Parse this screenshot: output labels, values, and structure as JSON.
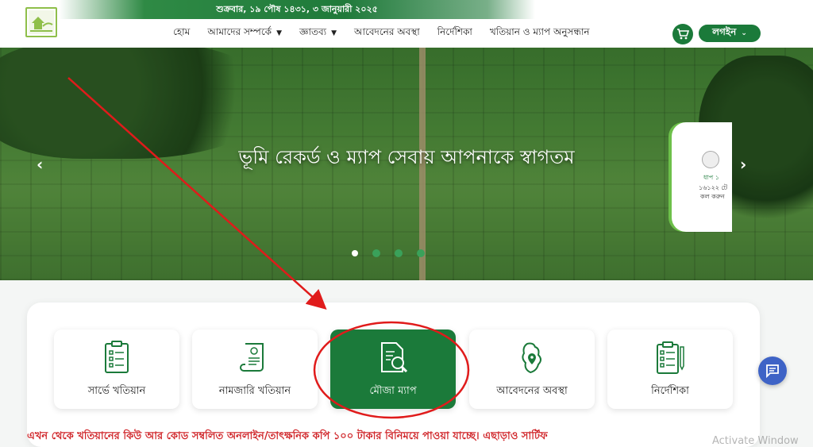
{
  "header": {
    "date_text": "শুক্রবার, ১৯ পৌষ ১৪৩১, ৩ জানুয়ারী ২০২৫",
    "logo_icon": "house-land-logo-icon",
    "nav": [
      {
        "label": "হোম",
        "has_dropdown": false
      },
      {
        "label": "আমাদের সম্পর্কে",
        "has_dropdown": true
      },
      {
        "label": "জ্ঞাতব্য",
        "has_dropdown": true
      },
      {
        "label": "আবেদনের অবস্থা",
        "has_dropdown": false
      },
      {
        "label": "নির্দেশিকা",
        "has_dropdown": false
      },
      {
        "label": "খতিয়ান ও ম্যাপ অনুসন্ধান",
        "has_dropdown": false
      }
    ],
    "cart_icon": "cart-icon",
    "login_label": "লগইন"
  },
  "hero": {
    "title": "ভূমি রেকর্ড ও ম্যাপ সেবায় আপনাকে স্বাগতম",
    "prev_icon": "chevron-left-icon",
    "next_icon": "chevron-right-icon",
    "slide_count": 4,
    "active_slide": 0,
    "side_card": {
      "line1": "ধাপ ১",
      "line2": "১৬১২২ টে",
      "line3": "কল করুন"
    }
  },
  "services": {
    "cards": [
      {
        "label": "সার্ভে খতিয়ান",
        "icon": "survey-document-icon",
        "active": false
      },
      {
        "label": "নামজারি খতিয়ান",
        "icon": "certificate-document-icon",
        "active": false
      },
      {
        "label": "মৌজা ম্যাপ",
        "icon": "document-search-icon",
        "active": true
      },
      {
        "label": "আবেদনের অবস্থা",
        "icon": "map-location-icon",
        "active": false
      },
      {
        "label": "নির্দেশিকা",
        "icon": "checklist-clipboard-icon",
        "active": false
      }
    ]
  },
  "notice": {
    "text": "এখন থেকে খতিয়ানের কিউ আর কোড সম্বলিত অনলাইন/তাৎক্ষনিক কপি ১০০ টাকার বিনিময়ে পাওয়া যাচ্ছে। এছাড়াও সার্টিফ"
  },
  "chat": {
    "icon": "chat-icon"
  },
  "watermark": {
    "text": "Activate Window"
  },
  "colors": {
    "brand_green": "#1b7a3a",
    "notice_red": "#d0262a",
    "annotation_red": "#e01b1b",
    "chat_blue": "#3e63c6"
  }
}
